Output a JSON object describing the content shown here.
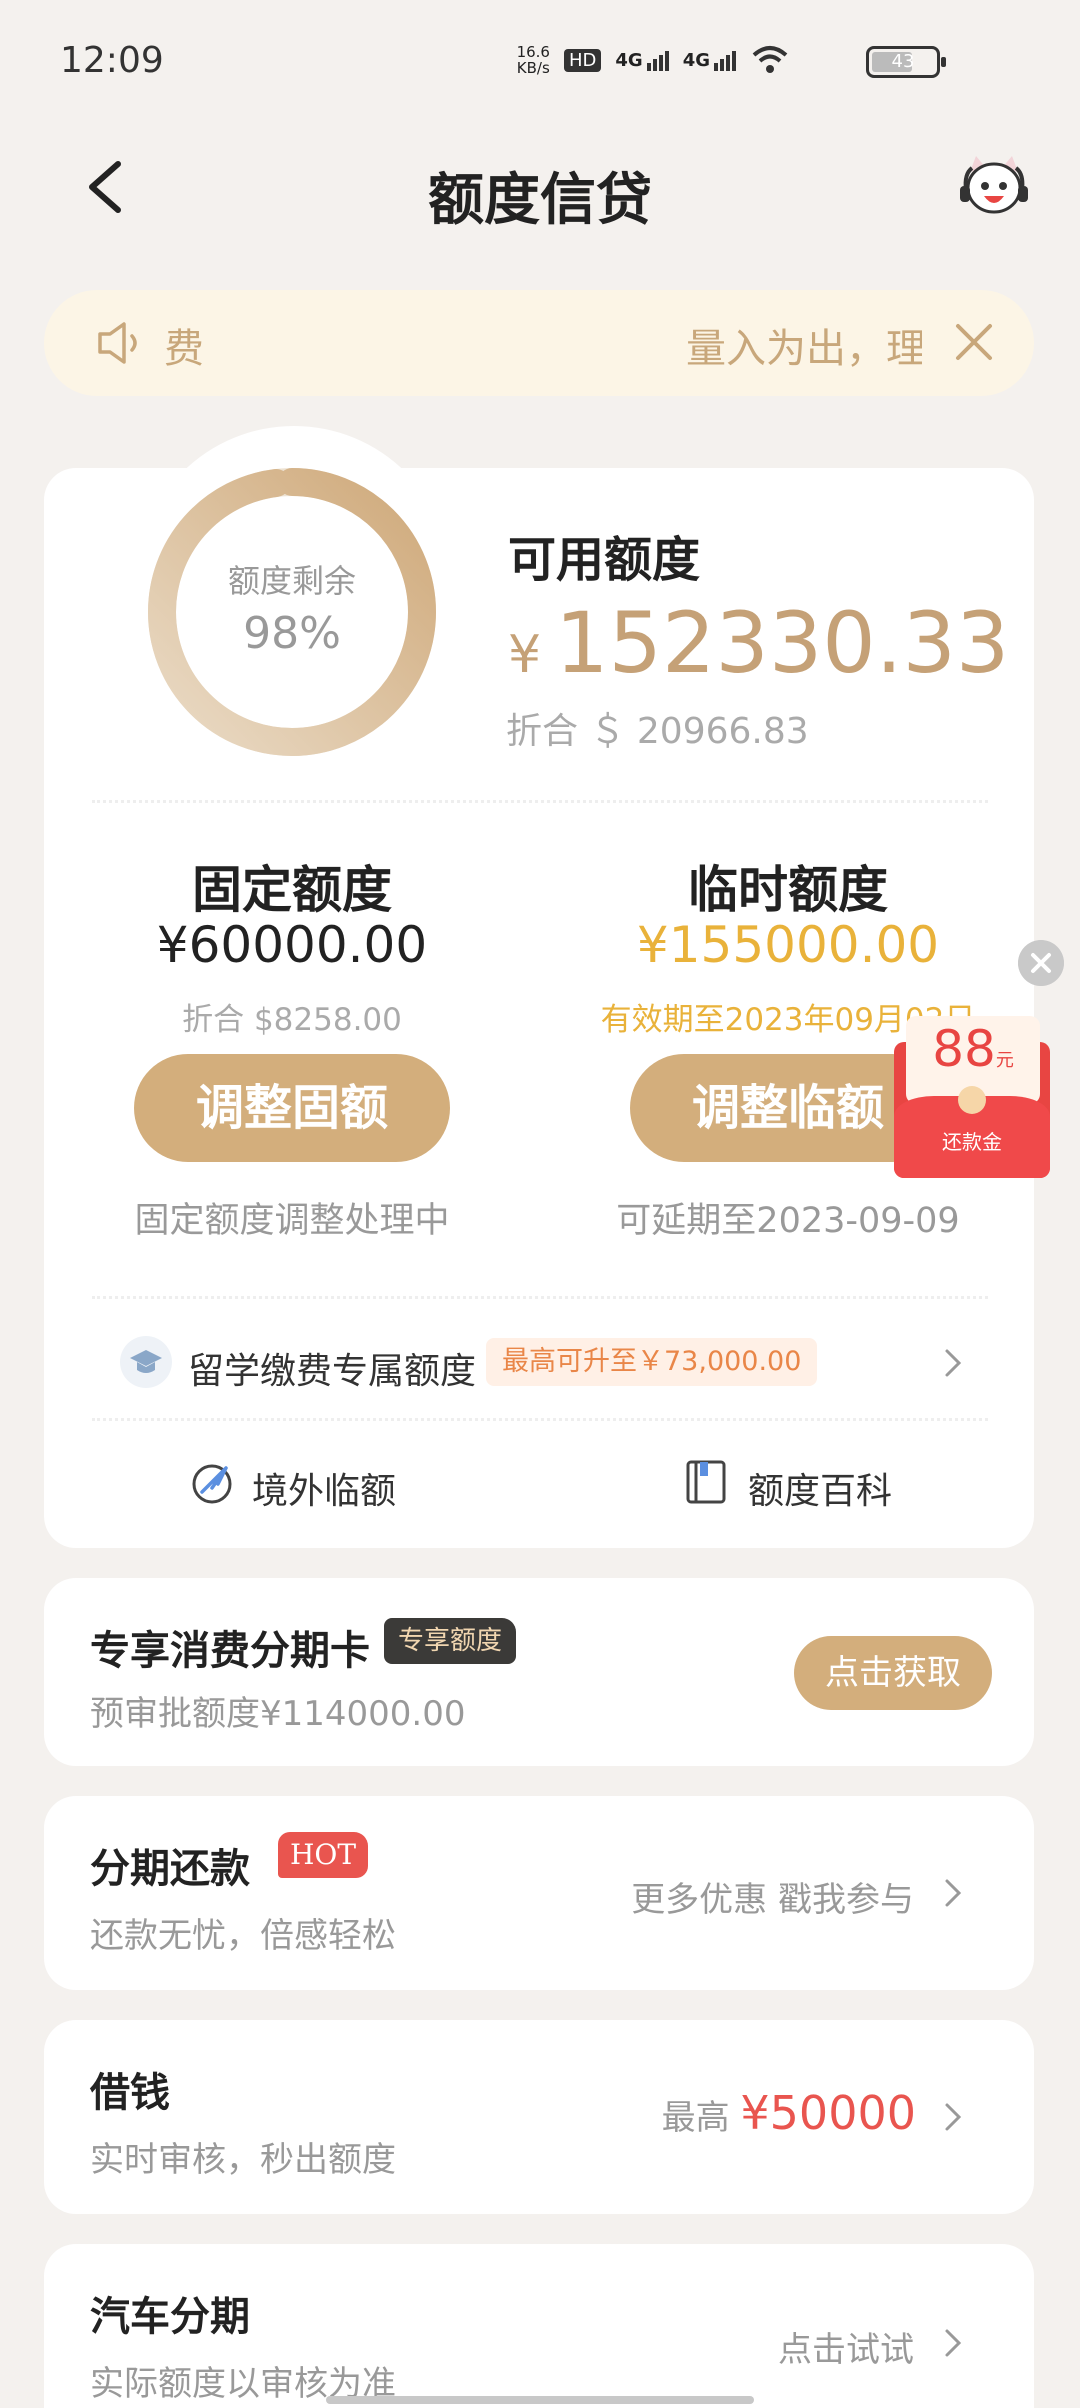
{
  "status": {
    "time": "12:09",
    "net_speed_value": "16.6",
    "net_speed_unit": "KB/s",
    "hd": "HD",
    "sim1": "4G",
    "sim2": "4G",
    "battery": "43"
  },
  "header": {
    "title": "额度信贷"
  },
  "notice": {
    "left_char": "费",
    "text": "量入为出，理"
  },
  "credit": {
    "ring_label": "额度剩余",
    "ring_percent": "98%",
    "ring_fraction": 0.98,
    "available_label": "可用额度",
    "currency": "¥",
    "available_amount": "152330.33",
    "converted": "折合 ＄ 20966.83"
  },
  "fixed": {
    "title": "固定额度",
    "amount": "¥60000.00",
    "sub": "折合 $8258.00",
    "button": "调整固额",
    "note": "固定额度调整处理中"
  },
  "temp": {
    "title": "临时额度",
    "amount": "¥155000.00",
    "sub": "有效期至2023年09月02日",
    "button": "调整临额",
    "note": "可延期至2023-09-09"
  },
  "study": {
    "label": "留学缴费专属额度",
    "tag": "最高可升至￥73,000.00"
  },
  "links": {
    "overseas": "境外临额",
    "wiki": "额度百科"
  },
  "packet": {
    "amount": "88",
    "unit": "元",
    "label": "还款金"
  },
  "card_installment": {
    "title": "专享消费分期卡",
    "tag": "专享额度",
    "sub": "预审批额度¥114000.00",
    "button": "点击获取"
  },
  "card_repay": {
    "title": "分期还款",
    "hot": "HOT",
    "sub": "还款无忧，倍感轻松",
    "right": "更多优惠 戳我参与"
  },
  "card_borrow": {
    "title": "借钱",
    "sub": "实时审核，秒出额度",
    "right_prefix": "最高",
    "right_amount": "¥50000"
  },
  "card_car": {
    "title": "汽车分期",
    "sub": "实际额度以审核为准",
    "right": "点击试试"
  },
  "colors": {
    "gold": "#d3ae7c",
    "accent_yellow": "#e9b23a",
    "red": "#e9554f"
  }
}
